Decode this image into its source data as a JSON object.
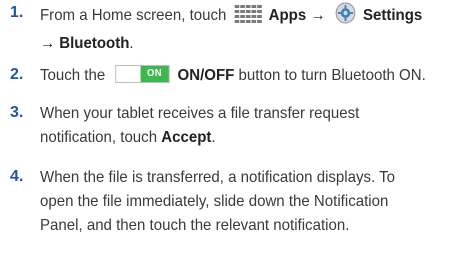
{
  "steps": [
    {
      "number": "1.",
      "parts": {
        "t1": "From a Home screen, touch",
        "apps": "Apps",
        "arrow1": "→",
        "settings": "Settings",
        "arrow2": "→",
        "bluetooth": "Bluetooth",
        "end": "."
      },
      "icons": [
        "apps-grid-icon",
        "settings-gear-icon"
      ]
    },
    {
      "number": "2.",
      "parts": {
        "t1": "Touch the",
        "toggle_text": "ON",
        "onoff": "ON/OFF",
        "t2": "button to turn Bluetooth ON."
      },
      "toggle_color": "#3fb74f"
    },
    {
      "number": "3.",
      "lines": [
        "When your tablet receives a file transfer request",
        "notification, touch"
      ],
      "accept": "Accept",
      "end": "."
    },
    {
      "number": "4.",
      "lines": [
        "When the file is transferred, a notification displays. To",
        "open the file immediately, slide down the Notification",
        "Panel, and then touch the relevant notification."
      ]
    }
  ],
  "colors": {
    "step_number": "#1e56a0",
    "text": "#3a3a3a",
    "bold": "#222222"
  }
}
